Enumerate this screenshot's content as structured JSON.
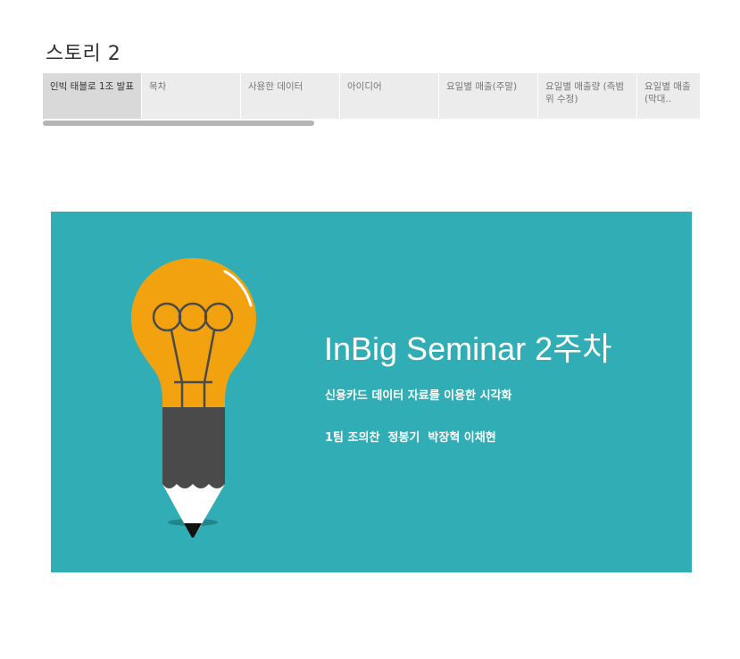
{
  "story": {
    "title": "스토리 2"
  },
  "tabs": [
    {
      "label": "인빅 태블로 1조 발표"
    },
    {
      "label": "목차"
    },
    {
      "label": "사용한 데이터"
    },
    {
      "label": "아이디어"
    },
    {
      "label": "요일별 매출(주말)"
    },
    {
      "label": "요일별 매출량 (측범위 수정)"
    },
    {
      "label": "요일별 매출(막대.."
    }
  ],
  "slide": {
    "title": "InBig Seminar 2주차",
    "subtitle": "신용카드 데이터 자료를 이용한 시각화",
    "team": "1팀 조의찬  정봉기  박장혁 이채현",
    "illustration_icon": "lightbulb-pencil-icon"
  },
  "colors": {
    "slide_background": "#31adb5",
    "bulb": "#f2a20f",
    "pencil_body": "#4a4a4a",
    "active_tab": "#d9d9d9",
    "tab_bar": "#ececec"
  }
}
